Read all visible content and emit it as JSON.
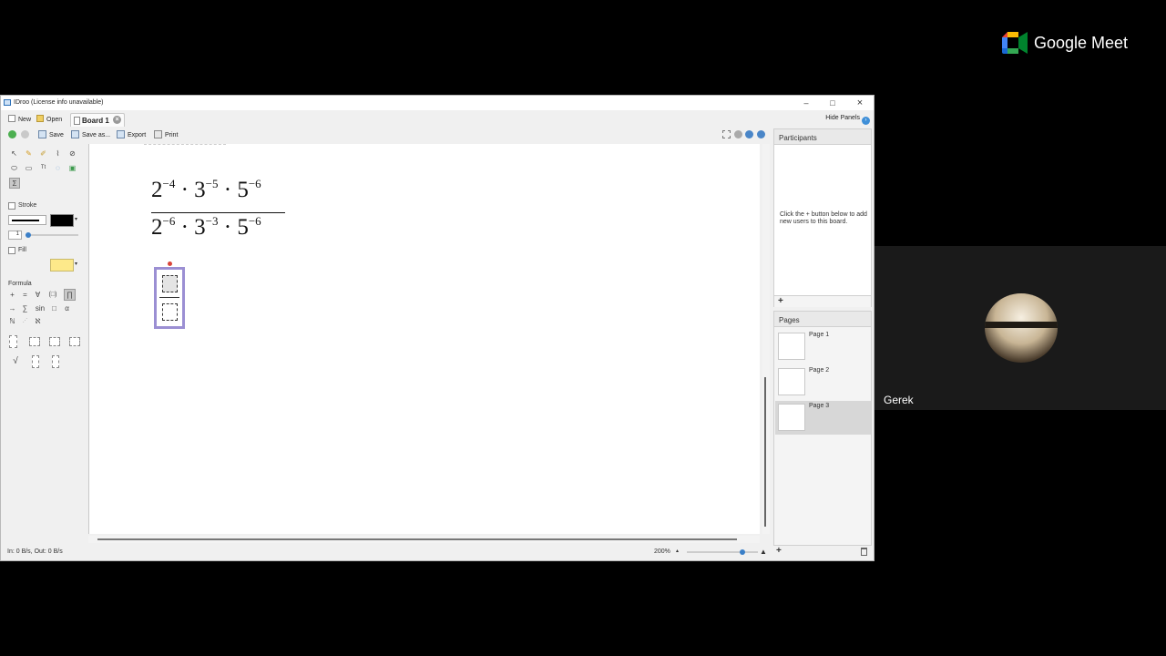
{
  "window": {
    "title": "IDroo (License info unavailable)",
    "controls": [
      "–",
      "□",
      "×"
    ]
  },
  "tabbar": {
    "new_label": "New",
    "open_label": "Open",
    "board_tab_label": "Board 1",
    "hide_panels_label": "Hide Panels"
  },
  "toolbar": {
    "save_label": "Save",
    "save_as_label": "Save as...",
    "export_label": "Export",
    "print_label": "Print"
  },
  "palette": {
    "tools": [
      "select-icon",
      "pencil-icon",
      "highlighter-icon",
      "polyline-icon",
      "eraser-icon",
      "ellipse-icon",
      "rectangle-icon",
      "text-icon",
      "comment-icon",
      "image-icon",
      "formula-tool-icon"
    ],
    "stroke_label": "Stroke",
    "stroke_width": "1",
    "stroke_color": "#000000",
    "fill_label": "Fill",
    "fill_color": "#fde98a",
    "formula_label": "Formula",
    "formula_row1": [
      "+",
      "=",
      "∀",
      "(□)",
      "∏"
    ],
    "formula_row2": [
      "→",
      "∑",
      "sin",
      "□",
      "α"
    ],
    "formula_row3": [
      "ℕ",
      "",
      "ℵ"
    ]
  },
  "canvas": {
    "numerator": {
      "b1": "2",
      "e1": "−4",
      "b2": "3",
      "e2": "−5",
      "b3": "5",
      "e3": "−6"
    },
    "denominator": {
      "b1": "2",
      "e1": "−6",
      "b2": "3",
      "e2": "−3",
      "b3": "5",
      "e3": "−6"
    },
    "dot": "·"
  },
  "participants": {
    "header": "Participants",
    "hint": "Click the + button below to add new users to this board.",
    "add_symbol": "+"
  },
  "pages": {
    "header": "Pages",
    "items": [
      {
        "label": "Page 1"
      },
      {
        "label": "Page 2"
      },
      {
        "label": "Page 3",
        "selected": true
      }
    ],
    "add_symbol": "+"
  },
  "status": {
    "traffic": "In: 0 B/s, Out: 0 B/s",
    "zoom": "200%",
    "zoom_level": 0.8
  },
  "meet": {
    "brand": "Google Meet",
    "participant_name": "Gerek"
  },
  "colors": {
    "selection": "#9b8fd3",
    "meet_bg": "#000000",
    "tile_bg": "#1a1a1a"
  }
}
